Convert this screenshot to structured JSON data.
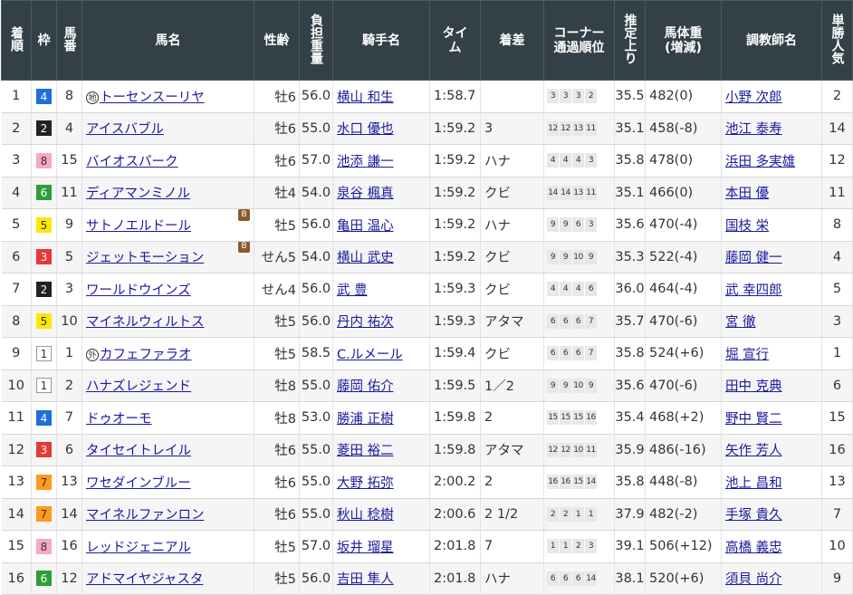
{
  "headers": {
    "rank": "着順",
    "waku": "枠",
    "num": "馬番",
    "horse": "馬名",
    "sexage": "性齢",
    "weight": "負担重量",
    "jockey": "騎手名",
    "time": "タイム",
    "margin": "着差",
    "corner": "コーナー通過順位",
    "last3f": "推定上り",
    "bodyweight": "馬体重(増減)",
    "trainer": "調教師名",
    "pop": "単勝人気"
  },
  "waku_colors": {
    "1": {
      "bg": "#ffffff",
      "fg": "#333333",
      "border": "#999999"
    },
    "2": {
      "bg": "#222222",
      "fg": "#ffffff",
      "border": "#222222"
    },
    "3": {
      "bg": "#e53935",
      "fg": "#ffffff",
      "border": "#e53935"
    },
    "4": {
      "bg": "#1e6fd9",
      "fg": "#ffffff",
      "border": "#1e6fd9"
    },
    "5": {
      "bg": "#ffe600",
      "fg": "#333333",
      "border": "#ffe600"
    },
    "6": {
      "bg": "#2e9e3a",
      "fg": "#ffffff",
      "border": "#2e9e3a"
    },
    "7": {
      "bg": "#ff9a1f",
      "fg": "#333333",
      "border": "#ff9a1f"
    },
    "8": {
      "bg": "#f7a8c4",
      "fg": "#333333",
      "border": "#f7a8c4"
    }
  },
  "rows": [
    {
      "rank": "1",
      "waku": "4",
      "num": "8",
      "mark": "地",
      "horse": "トーセンスーリヤ",
      "blinker": "",
      "sex_age": "牡6",
      "weight": "56.0",
      "jockey": "横山 和生",
      "time": "1:58.7",
      "margin": "",
      "corners": [
        "3",
        "3",
        "3",
        "2"
      ],
      "last3f": "35.5",
      "body": "482(0)",
      "trainer": "小野 次郎",
      "pop": "2"
    },
    {
      "rank": "2",
      "waku": "2",
      "num": "4",
      "mark": "",
      "horse": "アイスバブル",
      "blinker": "",
      "sex_age": "牡6",
      "weight": "55.0",
      "jockey": "水口 優也",
      "time": "1:59.2",
      "margin": "3",
      "corners": [
        "12",
        "12",
        "13",
        "11"
      ],
      "last3f": "35.1",
      "body": "458(-8)",
      "trainer": "池江 泰寿",
      "pop": "14"
    },
    {
      "rank": "3",
      "waku": "8",
      "num": "15",
      "mark": "",
      "horse": "バイオスパーク",
      "blinker": "",
      "sex_age": "牡6",
      "weight": "57.0",
      "jockey": "池添 謙一",
      "time": "1:59.2",
      "margin": "ハナ",
      "corners": [
        "4",
        "4",
        "4",
        "3"
      ],
      "last3f": "35.8",
      "body": "478(0)",
      "trainer": "浜田 多実雄",
      "pop": "12"
    },
    {
      "rank": "4",
      "waku": "6",
      "num": "11",
      "mark": "",
      "horse": "ディアマンミノル",
      "blinker": "",
      "sex_age": "牡4",
      "weight": "54.0",
      "jockey": "泉谷 楓真",
      "time": "1:59.2",
      "margin": "クビ",
      "corners": [
        "14",
        "14",
        "13",
        "11"
      ],
      "last3f": "35.1",
      "body": "466(0)",
      "trainer": "本田 優",
      "pop": "11"
    },
    {
      "rank": "5",
      "waku": "5",
      "num": "9",
      "mark": "",
      "horse": "サトノエルドール",
      "blinker": "B",
      "sex_age": "牡5",
      "weight": "56.0",
      "jockey": "亀田 温心",
      "time": "1:59.2",
      "margin": "ハナ",
      "corners": [
        "9",
        "9",
        "6",
        "3"
      ],
      "last3f": "35.6",
      "body": "470(-4)",
      "trainer": "国枝 栄",
      "pop": "8"
    },
    {
      "rank": "6",
      "waku": "3",
      "num": "5",
      "mark": "",
      "horse": "ジェットモーション",
      "blinker": "B",
      "sex_age": "せん5",
      "weight": "54.0",
      "jockey": "横山 武史",
      "time": "1:59.2",
      "margin": "クビ",
      "corners": [
        "9",
        "9",
        "10",
        "9"
      ],
      "last3f": "35.3",
      "body": "522(-4)",
      "trainer": "藤岡 健一",
      "pop": "4"
    },
    {
      "rank": "7",
      "waku": "2",
      "num": "3",
      "mark": "",
      "horse": "ワールドウインズ",
      "blinker": "",
      "sex_age": "せん4",
      "weight": "56.0",
      "jockey": "武 豊",
      "time": "1:59.3",
      "margin": "クビ",
      "corners": [
        "4",
        "4",
        "4",
        "6"
      ],
      "last3f": "36.0",
      "body": "464(-4)",
      "trainer": "武 幸四郎",
      "pop": "5"
    },
    {
      "rank": "8",
      "waku": "5",
      "num": "10",
      "mark": "",
      "horse": "マイネルウィルトス",
      "blinker": "",
      "sex_age": "牡5",
      "weight": "56.0",
      "jockey": "丹内 祐次",
      "time": "1:59.3",
      "margin": "アタマ",
      "corners": [
        "6",
        "6",
        "6",
        "7"
      ],
      "last3f": "35.7",
      "body": "470(-6)",
      "trainer": "宮 徹",
      "pop": "3"
    },
    {
      "rank": "9",
      "waku": "1",
      "num": "1",
      "mark": "外",
      "horse": "カフェファラオ",
      "blinker": "",
      "sex_age": "牡5",
      "weight": "58.5",
      "jockey": "C.ルメール",
      "time": "1:59.4",
      "margin": "クビ",
      "corners": [
        "6",
        "6",
        "6",
        "7"
      ],
      "last3f": "35.8",
      "body": "524(+6)",
      "trainer": "堀 宣行",
      "pop": "1"
    },
    {
      "rank": "10",
      "waku": "1",
      "num": "2",
      "mark": "",
      "horse": "ハナズレジェンド",
      "blinker": "",
      "sex_age": "牡8",
      "weight": "55.0",
      "jockey": "藤岡 佑介",
      "time": "1:59.5",
      "margin": "1／2",
      "corners": [
        "9",
        "9",
        "10",
        "9"
      ],
      "last3f": "35.6",
      "body": "470(-6)",
      "trainer": "田中 克典",
      "pop": "6"
    },
    {
      "rank": "11",
      "waku": "4",
      "num": "7",
      "mark": "",
      "horse": "ドゥオーモ",
      "blinker": "",
      "sex_age": "牡8",
      "weight": "53.0",
      "jockey": "勝浦 正樹",
      "time": "1:59.8",
      "margin": "2",
      "corners": [
        "15",
        "15",
        "15",
        "16"
      ],
      "last3f": "35.4",
      "body": "468(+2)",
      "trainer": "野中 賢二",
      "pop": "15"
    },
    {
      "rank": "12",
      "waku": "3",
      "num": "6",
      "mark": "",
      "horse": "タイセイトレイル",
      "blinker": "",
      "sex_age": "牡6",
      "weight": "55.0",
      "jockey": "菱田 裕二",
      "time": "1:59.8",
      "margin": "アタマ",
      "corners": [
        "12",
        "12",
        "10",
        "11"
      ],
      "last3f": "35.9",
      "body": "486(-16)",
      "trainer": "矢作 芳人",
      "pop": "16"
    },
    {
      "rank": "13",
      "waku": "7",
      "num": "13",
      "mark": "",
      "horse": "ワセダインブルー",
      "blinker": "",
      "sex_age": "牡6",
      "weight": "55.0",
      "jockey": "大野 拓弥",
      "time": "2:00.2",
      "margin": "2",
      "corners": [
        "16",
        "16",
        "15",
        "14"
      ],
      "last3f": "35.8",
      "body": "448(-8)",
      "trainer": "池上 昌和",
      "pop": "13"
    },
    {
      "rank": "14",
      "waku": "7",
      "num": "14",
      "mark": "",
      "horse": "マイネルファンロン",
      "blinker": "",
      "sex_age": "牡6",
      "weight": "55.0",
      "jockey": "秋山 稔樹",
      "time": "2:00.6",
      "margin": "2 1/2",
      "corners": [
        "2",
        "2",
        "1",
        "1"
      ],
      "last3f": "37.9",
      "body": "482(-2)",
      "trainer": "手塚 貴久",
      "pop": "7"
    },
    {
      "rank": "15",
      "waku": "8",
      "num": "16",
      "mark": "",
      "horse": "レッドジェニアル",
      "blinker": "",
      "sex_age": "牡5",
      "weight": "57.0",
      "jockey": "坂井 瑠星",
      "time": "2:01.8",
      "margin": "7",
      "corners": [
        "1",
        "1",
        "2",
        "3"
      ],
      "last3f": "39.1",
      "body": "506(+12)",
      "trainer": "高橋 義忠",
      "pop": "10"
    },
    {
      "rank": "16",
      "waku": "6",
      "num": "12",
      "mark": "",
      "horse": "アドマイヤジャスタ",
      "blinker": "",
      "sex_age": "牡5",
      "weight": "56.0",
      "jockey": "吉田 隼人",
      "time": "2:01.8",
      "margin": "ハナ",
      "corners": [
        "6",
        "6",
        "6",
        "14"
      ],
      "last3f": "38.1",
      "body": "520(+6)",
      "trainer": "須貝 尚介",
      "pop": "9"
    }
  ]
}
